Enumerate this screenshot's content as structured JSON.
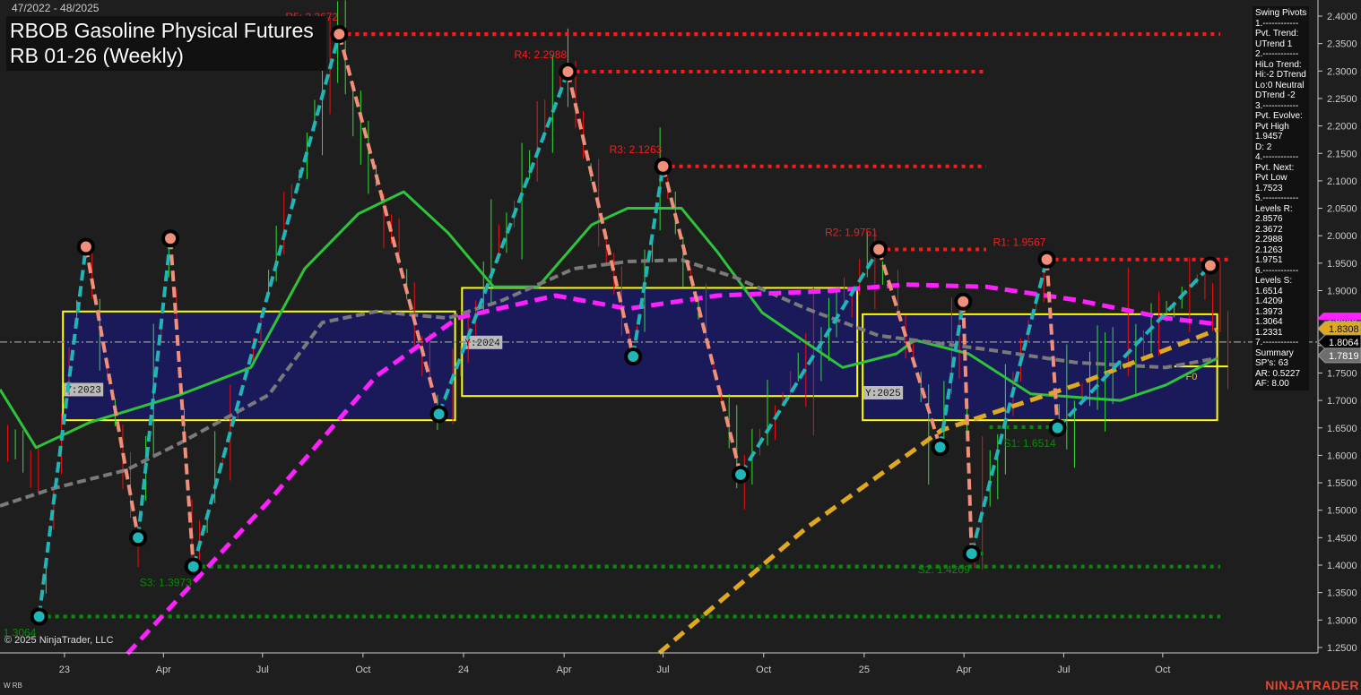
{
  "header": {
    "date_range": "47/2022 - 48/2025",
    "title_line1": "RBOB Gasoline Physical Futures",
    "title_line2": "RB 01-26 (Weekly)"
  },
  "footer": {
    "copyright": "© 2025 NinjaTrader, LLC",
    "series_label": "W RB",
    "logo": "NINJATRADER"
  },
  "info_panel": {
    "lines": [
      "Swing Pivots",
      "1.------------",
      "Pvt. Trend:",
      "UTrend 1",
      "2.------------",
      "HiLo Trend:",
      "Hi:-2 DTrend",
      "Lo:0 Neutral",
      "DTrend -2",
      "3.------------",
      "Pvt. Evolve:",
      "Pvt High",
      "1.9457",
      "D: 2",
      "4.------------",
      "Pvt. Next:",
      "Pvt Low",
      "1.7523",
      "5.------------",
      "Levels R:",
      "2.8576",
      "2.3672",
      "2.2988",
      "2.1263",
      "1.9751",
      "6.------------",
      "Levels S:",
      "1.6514",
      "1.4209",
      "1.3973",
      "1.3064",
      "1.2331",
      "7.------------",
      "Summary",
      "SP's: 63",
      "AR: 0.5227",
      "AF: 8.00"
    ]
  },
  "colors": {
    "background": "#1e1e1e",
    "resistance": "#ff1a1a",
    "support": "#0a8a0a",
    "pivot_high": "#f0907a",
    "pivot_low": "#22b5b5",
    "ma_green": "#2ec43a",
    "ma_gray": "#7a7a7a",
    "ma_magenta": "#ff20ff",
    "ma_gold": "#e0a820",
    "year_box": "#ffff00",
    "year_fill": "#1a1a5a"
  },
  "chart_data": {
    "type": "line",
    "title": "RBOB Gasoline Physical Futures RB 01-26 (Weekly)",
    "x_unit": "week index from 47/2022",
    "ylim": [
      1.25,
      2.4
    ],
    "y_ticks": [
      "2.4000",
      "2.3500",
      "2.3000",
      "2.2500",
      "2.2000",
      "2.1500",
      "2.1000",
      "2.0500",
      "2.0000",
      "1.9500",
      "1.9000",
      "1.8500",
      "1.8000",
      "1.7500",
      "1.7000",
      "1.6500",
      "1.6000",
      "1.5500",
      "1.5000",
      "1.4500",
      "1.4000",
      "1.3500",
      "1.3000",
      "1.2500"
    ],
    "x_ticks": [
      {
        "label": "23",
        "w": 8.4
      },
      {
        "label": "Apr",
        "w": 21.3
      },
      {
        "label": "Jul",
        "w": 34.2
      },
      {
        "label": "Oct",
        "w": 47.3
      },
      {
        "label": "24",
        "w": 60.4
      },
      {
        "label": "Apr",
        "w": 73.5
      },
      {
        "label": "Jul",
        "w": 86.4
      },
      {
        "label": "Oct",
        "w": 99.5
      },
      {
        "label": "25",
        "w": 112.6
      },
      {
        "label": "Apr",
        "w": 125.6
      },
      {
        "label": "Jul",
        "w": 138.6
      },
      {
        "label": "Oct",
        "w": 151.5
      }
    ],
    "swing_pivots": [
      {
        "w": 5.1,
        "p": 1.3064,
        "type": "low"
      },
      {
        "w": 11.2,
        "p": 1.98,
        "type": "high"
      },
      {
        "w": 18,
        "p": 1.45,
        "type": "low"
      },
      {
        "w": 22.2,
        "p": 1.995,
        "type": "high"
      },
      {
        "w": 25.2,
        "p": 1.3973,
        "type": "low"
      },
      {
        "w": 44.2,
        "p": 2.3672,
        "type": "high"
      },
      {
        "w": 57.2,
        "p": 1.675,
        "type": "low"
      },
      {
        "w": 74,
        "p": 2.2988,
        "type": "high"
      },
      {
        "w": 82.5,
        "p": 1.78,
        "type": "low"
      },
      {
        "w": 86.4,
        "p": 2.1263,
        "type": "high"
      },
      {
        "w": 96.5,
        "p": 1.565,
        "type": "low"
      },
      {
        "w": 114.5,
        "p": 1.9751,
        "type": "high"
      },
      {
        "w": 122.5,
        "p": 1.615,
        "type": "low"
      },
      {
        "w": 125.5,
        "p": 1.88,
        "type": "high"
      },
      {
        "w": 126.6,
        "p": 1.4209,
        "type": "low"
      },
      {
        "w": 136.4,
        "p": 1.9567,
        "type": "high"
      },
      {
        "w": 137.8,
        "p": 1.65,
        "type": "low"
      },
      {
        "w": 157.7,
        "p": 1.9457,
        "type": "high"
      }
    ],
    "levels": [
      {
        "label": "R5: 2.3672",
        "p": 2.3672,
        "from_w": 44.2,
        "kind": "R"
      },
      {
        "label": "R4: 2.2988",
        "p": 2.2988,
        "from_w": 74,
        "kind": "R"
      },
      {
        "label": "R3: 2.1263",
        "p": 2.1263,
        "from_w": 86.4,
        "kind": "R"
      },
      {
        "label": "R2: 1.9751",
        "p": 1.9751,
        "from_w": 114.5,
        "kind": "R"
      },
      {
        "label": "R1: 1.9567",
        "p": 1.9567,
        "from_w": 136.4,
        "kind": "R"
      },
      {
        "label": "S1: 1.6514",
        "p": 1.6514,
        "from_w": 137.8,
        "kind": "S"
      },
      {
        "label": "S2: 1.4209",
        "p": 1.4209,
        "from_w": 126.6,
        "kind": "S"
      },
      {
        "label": "S3: 1.3973",
        "p": 1.3973,
        "from_w": 25.2,
        "kind": "S"
      },
      {
        "label": "1.3064",
        "p": 1.3064,
        "from_w": 5.1,
        "kind": "S"
      }
    ],
    "year_boxes": [
      {
        "label": "Y:2023",
        "w0": 8.2,
        "w1": 59.3,
        "high": 1.862,
        "low": 1.664
      },
      {
        "label": "Y:2024",
        "w0": 60.2,
        "w1": 111.7,
        "high": 1.905,
        "low": 1.708
      },
      {
        "label": "Y:2025",
        "w0": 112.4,
        "w1": 158.6,
        "high": 1.857,
        "low": 1.664
      }
    ],
    "series": [
      {
        "name": "ma_green",
        "points": [
          [
            0,
            1.72
          ],
          [
            4.7,
            1.614
          ],
          [
            11.7,
            1.66
          ],
          [
            23.4,
            1.71
          ],
          [
            32.7,
            1.76
          ],
          [
            39.7,
            1.94
          ],
          [
            46.7,
            2.04
          ],
          [
            52.6,
            2.08
          ],
          [
            58.4,
            2.005
          ],
          [
            64.3,
            1.907
          ],
          [
            70.1,
            1.907
          ],
          [
            77.1,
            2.02
          ],
          [
            81.8,
            2.05
          ],
          [
            88.8,
            2.05
          ],
          [
            93.5,
            1.97
          ],
          [
            99.3,
            1.86
          ],
          [
            109.8,
            1.76
          ],
          [
            116.8,
            1.785
          ],
          [
            119.2,
            1.81
          ],
          [
            126.2,
            1.785
          ],
          [
            134.3,
            1.712
          ],
          [
            146,
            1.7
          ],
          [
            151.9,
            1.728
          ],
          [
            158.6,
            1.777
          ]
        ]
      },
      {
        "name": "ma_gray",
        "points": [
          [
            0,
            1.508
          ],
          [
            7,
            1.54
          ],
          [
            16.4,
            1.573
          ],
          [
            23.4,
            1.622
          ],
          [
            35,
            1.71
          ],
          [
            42,
            1.842
          ],
          [
            49,
            1.862
          ],
          [
            58.4,
            1.85
          ],
          [
            65.4,
            1.882
          ],
          [
            74.8,
            1.94
          ],
          [
            81.8,
            1.953
          ],
          [
            88.8,
            1.956
          ],
          [
            95.8,
            1.924
          ],
          [
            105.1,
            1.867
          ],
          [
            114.5,
            1.818
          ],
          [
            128.5,
            1.793
          ],
          [
            140.2,
            1.769
          ],
          [
            151.9,
            1.76
          ],
          [
            158.6,
            1.777
          ]
        ]
      },
      {
        "name": "ma_magenta",
        "points": [
          [
            16.6,
            1.2385
          ],
          [
            35,
            1.516
          ],
          [
            49,
            1.744
          ],
          [
            59.6,
            1.85
          ],
          [
            72.4,
            1.891
          ],
          [
            81.8,
            1.867
          ],
          [
            93.5,
            1.891
          ],
          [
            107.5,
            1.899
          ],
          [
            118,
            1.911
          ],
          [
            128.5,
            1.907
          ],
          [
            140.2,
            1.883
          ],
          [
            151.9,
            1.85
          ],
          [
            158.6,
            1.839
          ]
        ]
      },
      {
        "name": "ma_gold",
        "points": [
          [
            85.9,
            1.24
          ],
          [
            105,
            1.467
          ],
          [
            122.7,
            1.646
          ],
          [
            140.2,
            1.728
          ],
          [
            158.6,
            1.829
          ]
        ]
      }
    ],
    "price_tags": [
      {
        "value": "1.8308",
        "color": "#e0a820"
      },
      {
        "value": "1.8064",
        "color": "#000000"
      },
      {
        "value": "1.7819",
        "color": "#6e6e6e"
      }
    ],
    "f0_label": "F0",
    "f0_price": 1.762
  }
}
